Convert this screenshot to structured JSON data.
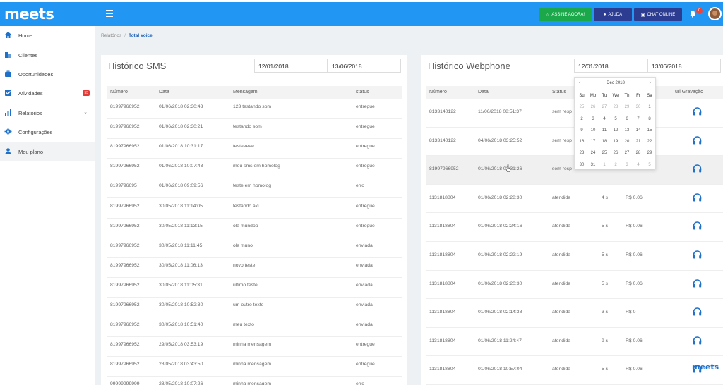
{
  "app": {
    "logo": "meets"
  },
  "topbar": {
    "assine_label": "ASSINE AGORA!",
    "ajuda_label": "AJUDA",
    "chat_label": "CHAT ONLINE",
    "notification_count": "0"
  },
  "sidebar": {
    "items": [
      {
        "label": "Home",
        "icon": "home-icon"
      },
      {
        "label": "Clientes",
        "icon": "building-icon"
      },
      {
        "label": "Oportunidades",
        "icon": "briefcase-icon"
      },
      {
        "label": "Atividades",
        "icon": "checkbox-icon",
        "badge": "55"
      },
      {
        "label": "Relatórios",
        "icon": "bar-chart-icon"
      },
      {
        "label": "Configurações",
        "icon": "gear-icon"
      },
      {
        "label": "Meu plano",
        "icon": "user-icon"
      }
    ]
  },
  "breadcrumb": {
    "parent": "Relatórios",
    "separator": "/",
    "current": "Total Voice"
  },
  "sms": {
    "title": "Histórico SMS",
    "date_from": "12/01/2018",
    "date_to": "13/06/2018",
    "columns": [
      "Número",
      "Data",
      "Mensagem",
      "status"
    ],
    "rows": [
      [
        "81997966952",
        "01/06/2018 02:30:43",
        "123 testando som",
        "entregue"
      ],
      [
        "81997966952",
        "01/06/2018 02:30:21",
        "testando som",
        "entregue"
      ],
      [
        "81997966952",
        "01/06/2018 10:31:17",
        "testeeeee",
        "entregue"
      ],
      [
        "81997966952",
        "01/06/2018 10:07:43",
        "meu sms em homolog",
        "entregue"
      ],
      [
        "8199796695",
        "01/06/2018 09:09:56",
        "teste em homolog",
        "erro"
      ],
      [
        "81997966952",
        "30/05/2018 11:14:05",
        "testando aki",
        "entregue"
      ],
      [
        "81997966952",
        "30/05/2018 11:13:15",
        "ola mundoo",
        "entregue"
      ],
      [
        "81997966952",
        "30/05/2018 11:11:45",
        "ola muno",
        "enviada"
      ],
      [
        "81997966952",
        "30/05/2018 11:06:13",
        "novo teste",
        "enviada"
      ],
      [
        "81997966952",
        "30/05/2018 11:05:31",
        "ultimo teste",
        "enviada"
      ],
      [
        "81997966952",
        "30/05/2018 10:52:30",
        "um outro texto",
        "enviada"
      ],
      [
        "81997966952",
        "30/05/2018 10:51:40",
        "meu texto",
        "enviada"
      ],
      [
        "81997966952",
        "29/05/2018 03:53:19",
        "minha mensagem",
        "entregue"
      ],
      [
        "81997966952",
        "28/05/2018 03:43:50",
        "minha mensagem",
        "entregue"
      ],
      [
        "99999999999",
        "28/05/2018 10:07:26",
        "minha mensagem",
        "erro"
      ]
    ]
  },
  "webphone": {
    "title": "Histórico Webphone",
    "date_from": "12/01/2018",
    "date_to": "13/06/2018",
    "columns": [
      "Número",
      "Data",
      "Status",
      "",
      "",
      "url Gravação"
    ],
    "rows": [
      [
        "8133140122",
        "11/06/2018 08:51:37",
        "sem resp",
        "",
        ""
      ],
      [
        "8133140122",
        "04/06/2018 03:25:52",
        "sem resp",
        "",
        ""
      ],
      [
        "81997966952",
        "01/06/2018 02:31:26",
        "sem resp",
        "",
        ""
      ],
      [
        "1131818804",
        "01/06/2018 02:28:30",
        "atendida",
        "4 s",
        "R$ 0.06"
      ],
      [
        "1131818804",
        "01/06/2018 02:24:16",
        "atendida",
        "5 s",
        "R$ 0.06"
      ],
      [
        "1131818804",
        "01/06/2018 02:22:19",
        "atendida",
        "5 s",
        "R$ 0.06"
      ],
      [
        "1131818804",
        "01/06/2018 02:20:30",
        "atendida",
        "5 s",
        "R$ 0.06"
      ],
      [
        "1131818804",
        "01/06/2018 02:14:38",
        "atendida",
        "3 s",
        "R$ 0"
      ],
      [
        "1131818804",
        "01/06/2018 11:24:47",
        "atendida",
        "9 s",
        "R$ 0.06"
      ],
      [
        "1131818804",
        "01/06/2018 10:57:04",
        "atendida",
        "5 s",
        "R$ 0.06"
      ]
    ]
  },
  "calendar": {
    "month_label": "Dec 2018",
    "prev": "‹",
    "next": "›",
    "weekdays": [
      "Su",
      "Mo",
      "Tu",
      "We",
      "Th",
      "Fr",
      "Sa"
    ],
    "days": [
      "25",
      "26",
      "27",
      "28",
      "29",
      "30",
      "1",
      "2",
      "3",
      "4",
      "5",
      "6",
      "7",
      "8",
      "9",
      "10",
      "11",
      "12",
      "13",
      "14",
      "15",
      "16",
      "17",
      "18",
      "19",
      "20",
      "21",
      "22",
      "23",
      "24",
      "25",
      "26",
      "27",
      "28",
      "29",
      "30",
      "31",
      "1",
      "2",
      "3",
      "4",
      "5"
    ]
  },
  "watermark": "meets",
  "colors": {
    "primary": "#2196f3",
    "assine": "#1aa84a",
    "ajuda": "#2b3c91",
    "link": "#1e5fb4",
    "headphone": "#1e70c8"
  }
}
